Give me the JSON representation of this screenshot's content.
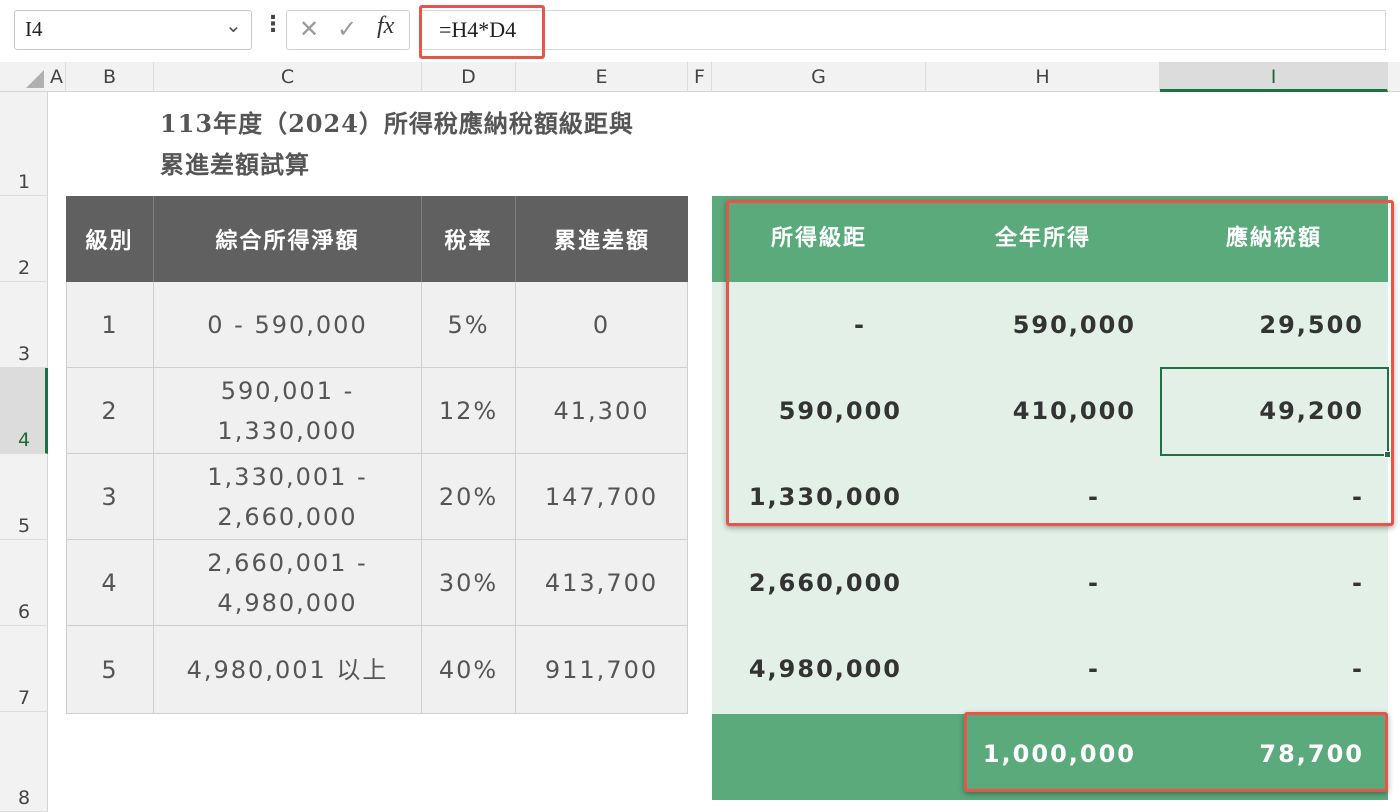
{
  "name_box": "I4",
  "formula": "=H4*D4",
  "columns": [
    "A",
    "B",
    "C",
    "D",
    "E",
    "F",
    "G",
    "H",
    "I"
  ],
  "rows": [
    "1",
    "2",
    "3",
    "4",
    "5",
    "6",
    "7",
    "8"
  ],
  "title": {
    "line1": "113年度（2024）所得稅應納稅額級距與",
    "line2": "累進差額試算"
  },
  "left_table": {
    "headers": [
      "級別",
      "綜合所得淨額",
      "稅率",
      "累進差額"
    ],
    "rows": [
      {
        "level": "1",
        "income_l1": "0 - 590,000",
        "income_l2": "",
        "rate": "5%",
        "diff": "0"
      },
      {
        "level": "2",
        "income_l1": "590,001 -",
        "income_l2": "1,330,000",
        "rate": "12%",
        "diff": "41,300"
      },
      {
        "level": "3",
        "income_l1": "1,330,001 -",
        "income_l2": "2,660,000",
        "rate": "20%",
        "diff": "147,700"
      },
      {
        "level": "4",
        "income_l1": "2,660,001 -",
        "income_l2": "4,980,000",
        "rate": "30%",
        "diff": "413,700"
      },
      {
        "level": "5",
        "income_l1": "4,980,001 以上",
        "income_l2": "",
        "rate": "40%",
        "diff": "911,700"
      }
    ]
  },
  "right_table": {
    "headers": [
      "所得級距",
      "全年所得",
      "應納稅額"
    ],
    "rows": [
      {
        "bracket": "-",
        "income": "590,000",
        "tax": "29,500"
      },
      {
        "bracket": "590,000",
        "income": "410,000",
        "tax": "49,200"
      },
      {
        "bracket": "1,330,000",
        "income": "-",
        "tax": "-"
      },
      {
        "bracket": "2,660,000",
        "income": "-",
        "tax": "-"
      },
      {
        "bracket": "4,980,000",
        "income": "-",
        "tax": "-"
      }
    ],
    "total_income": "1,000,000",
    "total_tax": "78,700"
  },
  "colors": {
    "dark_header": "#606060",
    "green_header": "#5aaa7c",
    "green_body": "#e2f0e7",
    "highlight": "#e8534a",
    "selection": "#1e7145"
  }
}
